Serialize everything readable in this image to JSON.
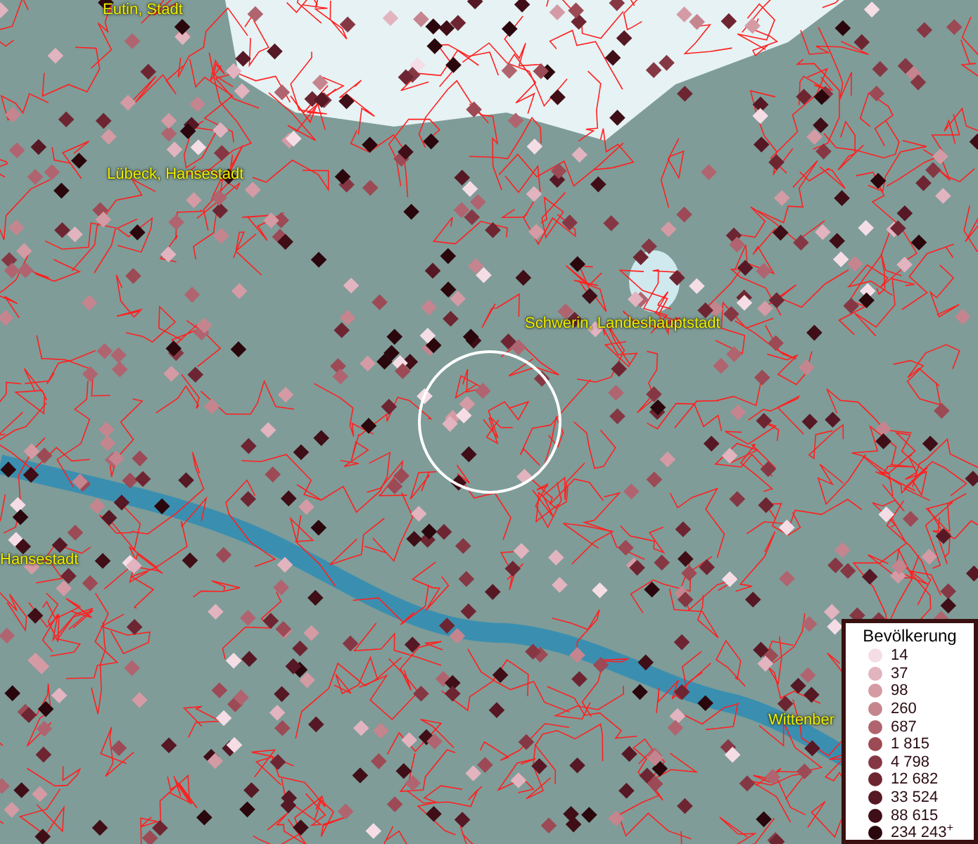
{
  "map": {
    "place_labels": [
      {
        "text": "Eutin, Stadt"
      },
      {
        "text": "Lübeck, Hansestadt"
      },
      {
        "text": "Schwerin, Landeshauptstadt"
      },
      {
        "text": "Hansestadt"
      },
      {
        "text": "Wittenber"
      }
    ]
  },
  "legend": {
    "title": "Bevölkerung",
    "entries": [
      {
        "label": "14",
        "color": "#f5dde6"
      },
      {
        "label": "37",
        "color": "#e2b4bf"
      },
      {
        "label": "98",
        "color": "#d49ba5"
      },
      {
        "label": "260",
        "color": "#c5858f"
      },
      {
        "label": "687",
        "color": "#b0646f"
      },
      {
        "label": "1 815",
        "color": "#9c4a55"
      },
      {
        "label": "4 798",
        "color": "#853844"
      },
      {
        "label": "12 682",
        "color": "#6e2532"
      },
      {
        "label": "33 524",
        "color": "#561824"
      },
      {
        "label": "88 615",
        "color": "#3f0e17"
      },
      {
        "label": "234 243$^{+}$",
        "color": "#2a070c"
      }
    ]
  }
}
